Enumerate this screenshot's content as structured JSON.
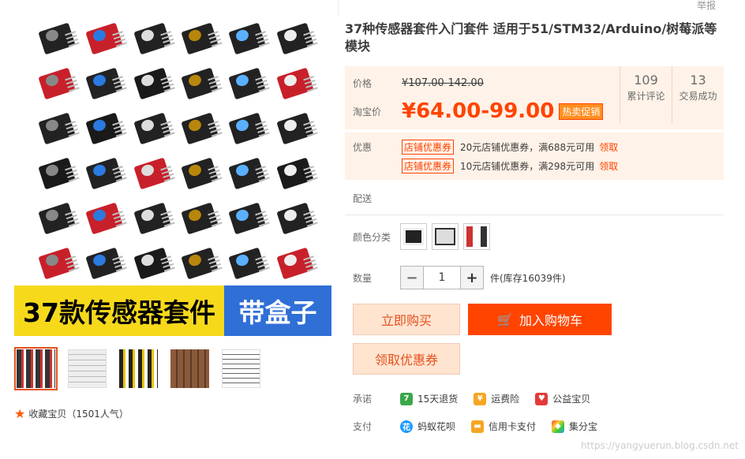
{
  "report_label": "举报",
  "product": {
    "title": "37种传感器套件入门套件 适用于51/STM32/Arduino/树莓派等模块",
    "banner_left": "37款传感器套件",
    "banner_right": "带盒子",
    "favorite": "收藏宝贝（1501人气）"
  },
  "price": {
    "label": "价格",
    "original": "¥107.00-142.00",
    "promo_label": "淘宝价",
    "current": "¥64.00-99.00",
    "hot_tag": "热卖促销",
    "reviews_count": "109",
    "reviews_label": "累计评论",
    "sales_count": "13",
    "sales_label": "交易成功"
  },
  "promo": {
    "label": "优惠",
    "coupons": [
      {
        "tag": "店铺优惠券",
        "text": "20元店铺优惠券，满688元可用",
        "action": "领取"
      },
      {
        "tag": "店铺优惠券",
        "text": "10元店铺优惠券，满298元可用",
        "action": "领取"
      }
    ]
  },
  "delivery_label": "配送",
  "color_label": "颜色分类",
  "quantity": {
    "label": "数量",
    "value": "1",
    "minus": "−",
    "plus": "+",
    "stock": "件(库存16039件)"
  },
  "buttons": {
    "buy": "立即购买",
    "cart": "加入购物车",
    "coupon": "领取优惠券"
  },
  "promise": {
    "label": "承诺",
    "items": [
      "15天退货",
      "运费险",
      "公益宝贝"
    ]
  },
  "payment": {
    "label": "支付",
    "items": [
      "蚂蚁花呗",
      "信用卡支付",
      "集分宝"
    ]
  },
  "watermark": "https://yangyuerun.blog.csdn.net",
  "colors": {
    "accent": "#ff4400",
    "price_bg": "#fff2e8",
    "banner_yellow": "#f7d91c",
    "banner_blue": "#2f6fd6"
  }
}
